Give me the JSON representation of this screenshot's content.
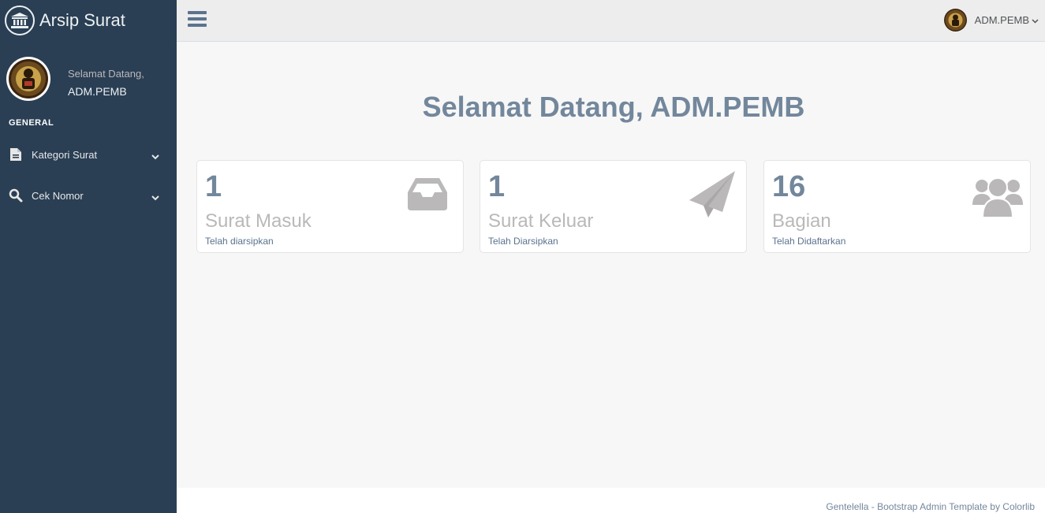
{
  "brand": {
    "title": "Arsip Surat",
    "icon": "institution-icon"
  },
  "profile": {
    "greeting": "Selamat Datang,",
    "name": "ADM.PEMB"
  },
  "sidebar": {
    "section_title": "GENERAL",
    "items": [
      {
        "label": "Kategori Surat",
        "icon": "file-text-icon"
      },
      {
        "label": "Cek Nomor",
        "icon": "search-icon"
      }
    ]
  },
  "topnav": {
    "user_name": "ADM.PEMB"
  },
  "main": {
    "welcome": "Selamat Datang, ADM.PEMB",
    "tiles": [
      {
        "count": "1",
        "label": "Surat Masuk",
        "sub": "Telah diarsipkan",
        "icon": "inbox-icon"
      },
      {
        "count": "1",
        "label": "Surat Keluar",
        "sub": "Telah Diarsipkan",
        "icon": "paper-plane-icon"
      },
      {
        "count": "16",
        "label": "Bagian",
        "sub": "Telah Didaftarkan",
        "icon": "users-icon"
      }
    ]
  },
  "footer": {
    "text": "Gentelella - Bootstrap Admin Template by Colorlib"
  },
  "colors": {
    "sidebar": "#2A3F54",
    "accent": "#73879C",
    "tile_icon": "#BAB8B8"
  }
}
